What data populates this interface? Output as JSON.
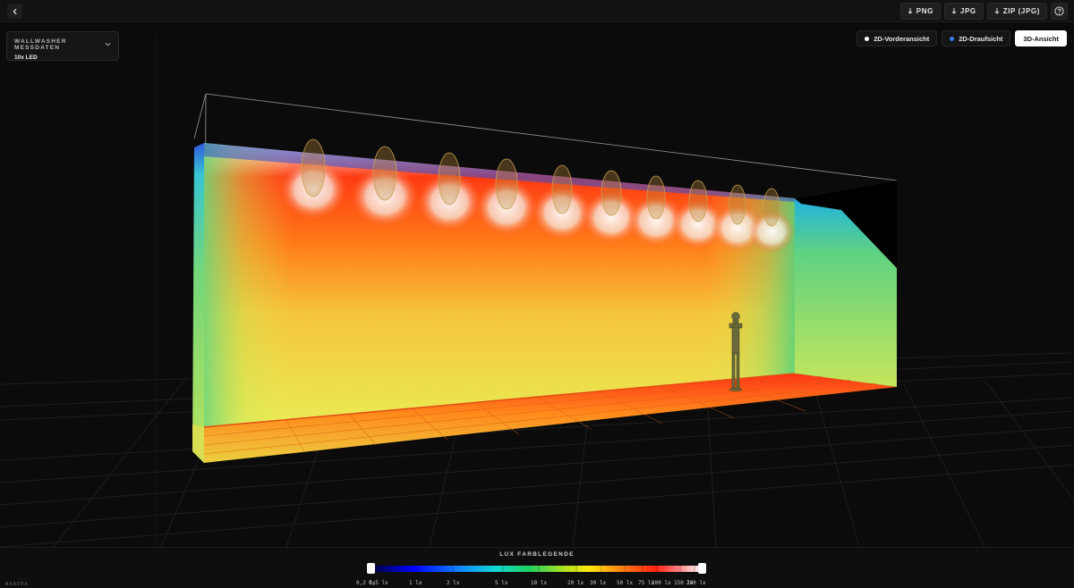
{
  "toolbar": {
    "downloads": [
      {
        "label": "PNG"
      },
      {
        "label": "JPG"
      },
      {
        "label": "ZIP (JPG)"
      }
    ]
  },
  "panel": {
    "title": "WALLWASHER MESSDATEN",
    "subtitle": "10x LED"
  },
  "views": [
    {
      "label": "2D-Vorderansicht",
      "dot_color": "#ffffff",
      "active": false
    },
    {
      "label": "2D-Draufsicht",
      "dot_color": "#3b7df0",
      "active": false
    },
    {
      "label": "3D-Ansicht",
      "dot_color": "",
      "active": true
    }
  ],
  "legend": {
    "title": "LUX FARBLEGENDE",
    "ticks": [
      "0,2 lx",
      "0,5 lx",
      "1 lx",
      "2 lx",
      "5 lx",
      "10 lx",
      "20 lx",
      "30 lx",
      "50 lx",
      "75 lx",
      "100 lx",
      "150 lx",
      "200 lx"
    ]
  },
  "brand": "NAAVEA",
  "colors": {
    "background": "#0b0b0b",
    "accent_blue": "#3b7df0",
    "heat_red": "#ff2a10",
    "heat_yellow": "#f2e84a",
    "heat_green": "#55d07a"
  }
}
